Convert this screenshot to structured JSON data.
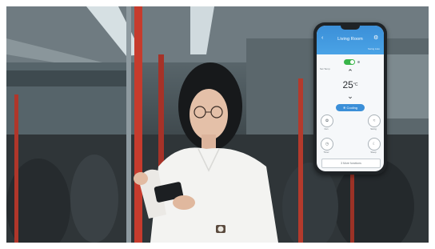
{
  "app": {
    "title": "Living Room",
    "header_sub": "Swing Auto",
    "side_label": "Set Temp",
    "temperature": "25",
    "temperature_unit": "°C",
    "mode_label": "Cooling",
    "power_on": true,
    "controls": [
      {
        "label": "Fan",
        "icon": "fan-icon"
      },
      {
        "label": "Swing",
        "icon": "swing-icon"
      },
      {
        "label": "Timer",
        "icon": "timer-icon"
      },
      {
        "label": "Sleep",
        "icon": "sleep-icon"
      }
    ],
    "more_button": "3 More functions"
  },
  "colors": {
    "accent": "#3b8fd8",
    "toggle_on": "#39b54a",
    "phone_body": "#1f2326"
  }
}
